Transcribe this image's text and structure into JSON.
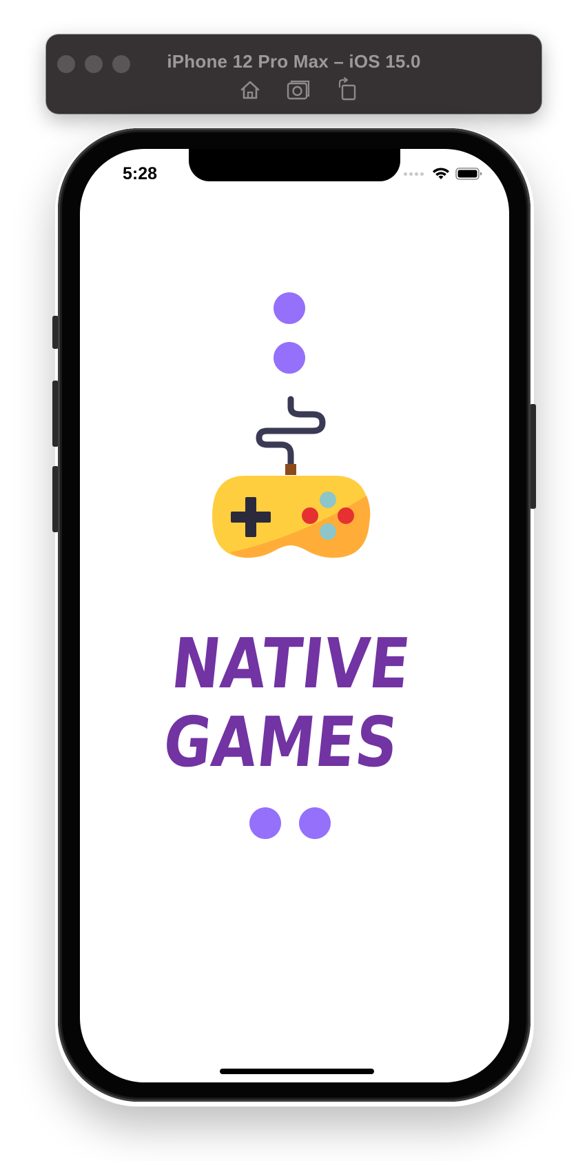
{
  "simulator": {
    "title": "iPhone 12 Pro Max – iOS 15.0",
    "buttons": {
      "home": "home-icon",
      "screenshot": "screenshot-icon",
      "rotate": "rotate-icon"
    }
  },
  "status_bar": {
    "time": "5:28",
    "wifi_icon": "wifi-icon",
    "battery_icon": "battery-icon"
  },
  "splash": {
    "logo_line1": "NATIVE",
    "logo_line2": "GAMES",
    "logo_color": "#7233a3",
    "dot_color": "#9470fb",
    "gamepad_icon": "gamepad-icon"
  },
  "colors": {
    "toolbar_bg": "#363233",
    "screen_bg": "#ffffff",
    "gamepad_body": "#ffce3f",
    "gamepad_shade": "#ffad38",
    "button_red": "#e53131",
    "button_teal": "#8cc6ca",
    "dpad": "#2a2a3c",
    "cable": "#3a3a55"
  }
}
